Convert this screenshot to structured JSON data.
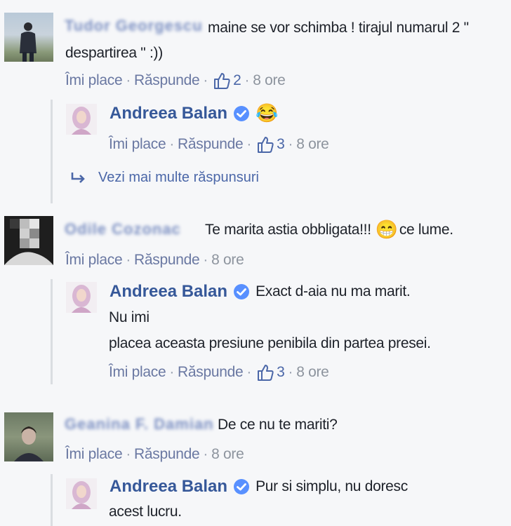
{
  "comments": [
    {
      "author": "Tudor Georgescu",
      "text_line1": "maine se vor schimba ! tirajul numarul 2 \"",
      "text_line2": "despartirea \" :))",
      "actions": {
        "like": "Îmi place",
        "reply": "Răspunde",
        "likes": "2",
        "time": "8 ore"
      },
      "reply": {
        "author": "Andreea Balan",
        "emoji": "😂",
        "actions": {
          "like": "Îmi place",
          "reply": "Răspunde",
          "likes": "3",
          "time": "8 ore"
        }
      },
      "more_replies": "Vezi mai multe răspunsuri"
    },
    {
      "author": "Odile Cozonac",
      "text_before": "Te marita astia obbligata!!!",
      "emoji": "😁",
      "text_after": "ce lume.",
      "actions": {
        "like": "Îmi place",
        "reply": "Răspunde",
        "time": "8 ore"
      },
      "reply": {
        "author": "Andreea Balan",
        "text_line1": "Exact d-aia nu ma marit.",
        "text_line2": "Nu imi",
        "text_line3": "placea aceasta presiune penibila din partea presei.",
        "actions": {
          "like": "Îmi place",
          "reply": "Răspunde",
          "likes": "3",
          "time": "8 ore"
        }
      }
    },
    {
      "author": "Geanina F. Damian",
      "text": "De ce nu te mariti?",
      "actions": {
        "like": "Îmi place",
        "reply": "Răspunde",
        "time": "8 ore"
      },
      "reply": {
        "author": "Andreea Balan",
        "text_line1": "Pur si simplu, nu doresc",
        "text_line2": "acest lucru."
      }
    }
  ],
  "colors": {
    "link": "#365899",
    "muted": "#8d949e",
    "action": "#6a78a2",
    "verified": "#5890ff"
  }
}
